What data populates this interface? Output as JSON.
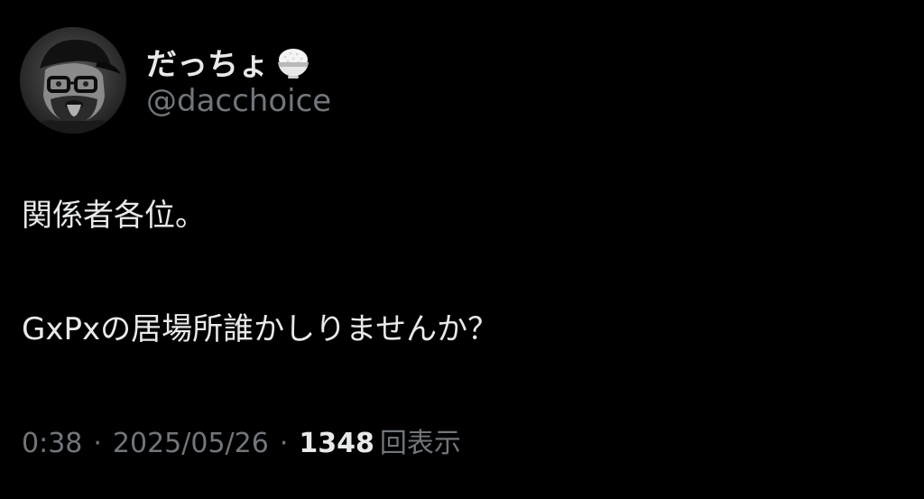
{
  "author": {
    "display_name": "だっちょ",
    "name_emoji": "rice-bowl-icon",
    "handle": "@dacchoice",
    "avatar": "avatar-photo"
  },
  "tweet": {
    "lines": [
      "関係者各位。",
      "GxPxの居場所誰かしりませんか？"
    ]
  },
  "meta": {
    "time": "0:38",
    "separator": "·",
    "date": "2025/05/26",
    "views_count": "1348",
    "views_label": "回表示"
  },
  "colors": {
    "background": "#000000",
    "primary_text": "#e7e9ea",
    "secondary_text": "#71767b"
  }
}
